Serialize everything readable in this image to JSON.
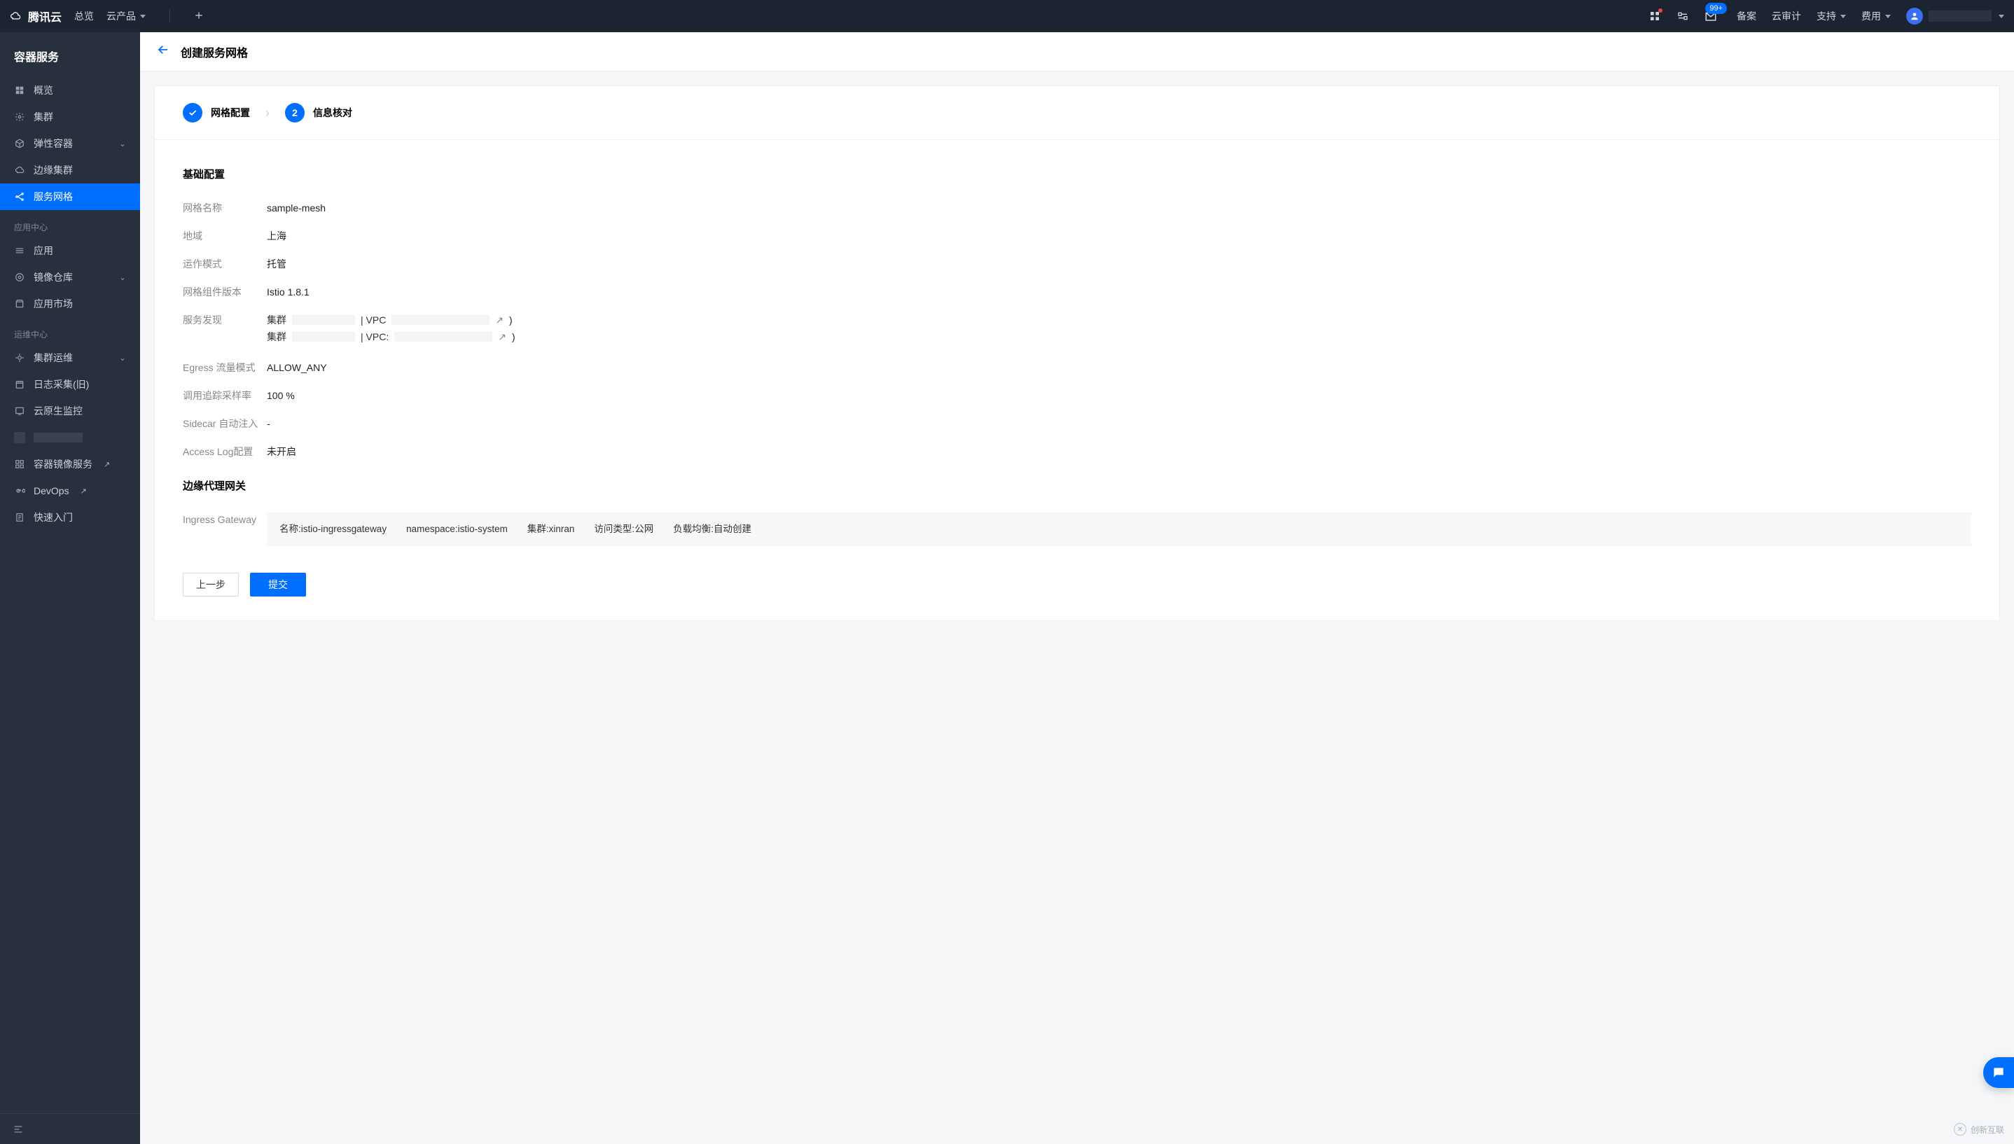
{
  "topbar": {
    "brand": "腾讯云",
    "links": {
      "overview": "总览",
      "products": "云产品"
    },
    "badge": "99+",
    "right": {
      "beian": "备案",
      "audit": "云审计",
      "support": "支持",
      "cost": "费用"
    }
  },
  "sidebar": {
    "product_title": "容器服务",
    "items": [
      {
        "key": "overview",
        "label": "概览"
      },
      {
        "key": "cluster",
        "label": "集群"
      },
      {
        "key": "eks",
        "label": "弹性容器",
        "expand": true
      },
      {
        "key": "edge",
        "label": "边缘集群"
      },
      {
        "key": "mesh",
        "label": "服务网格",
        "active": true
      }
    ],
    "cat_app": "应用中心",
    "app_items": [
      {
        "key": "app",
        "label": "应用"
      },
      {
        "key": "image",
        "label": "镜像仓库",
        "expand": true
      },
      {
        "key": "market",
        "label": "应用市场"
      }
    ],
    "cat_ops": "运维中心",
    "ops_items": [
      {
        "key": "clusterops",
        "label": "集群运维",
        "expand": true
      },
      {
        "key": "logs",
        "label": "日志采集(旧)"
      },
      {
        "key": "cloudnative",
        "label": "云原生监控"
      },
      {
        "key": "blank",
        "label": "",
        "redact": true
      },
      {
        "key": "tcr",
        "label": "容器镜像服务",
        "ext": true
      },
      {
        "key": "devops",
        "label": "DevOps",
        "ext": true
      },
      {
        "key": "quickstart",
        "label": "快速入门"
      }
    ]
  },
  "page": {
    "title": "创建服务网格",
    "steps": {
      "s1": "网格配置",
      "s2": "信息核对",
      "s2num": "2"
    }
  },
  "basic": {
    "section": "基础配置",
    "labels": {
      "name": "网格名称",
      "region": "地域",
      "mode": "运作模式",
      "version": "网格组件版本",
      "discovery": "服务发现",
      "egress": "Egress 流量模式",
      "sampling": "调用追踪采样率",
      "sidecar": "Sidecar 自动注入",
      "accesslog": "Access Log配置"
    },
    "values": {
      "name": "sample-mesh",
      "region": "上海",
      "mode": "托管",
      "version": "Istio 1.8.1",
      "egress": "ALLOW_ANY",
      "sampling": "100 %",
      "sidecar": "-",
      "accesslog": "未开启"
    },
    "discovery": [
      {
        "prefix": "集群",
        "mid": "| VPC",
        "paren": ")"
      },
      {
        "prefix": "集群",
        "mid": "| VPC:",
        "paren": ")"
      }
    ]
  },
  "gateway": {
    "section": "边缘代理网关",
    "label": "Ingress Gateway",
    "parts": {
      "name_k": "名称:",
      "name_v": "istio-ingressgateway",
      "ns_k": "namespace:",
      "ns_v": "istio-system",
      "cluster_k": "集群:",
      "cluster_v": "xinran",
      "access_k": "访问类型:",
      "access_v": "公网",
      "lb_k": "负载均衡:",
      "lb_v": "自动创建"
    }
  },
  "actions": {
    "prev": "上一步",
    "submit": "提交"
  },
  "watermark": "创新互联"
}
